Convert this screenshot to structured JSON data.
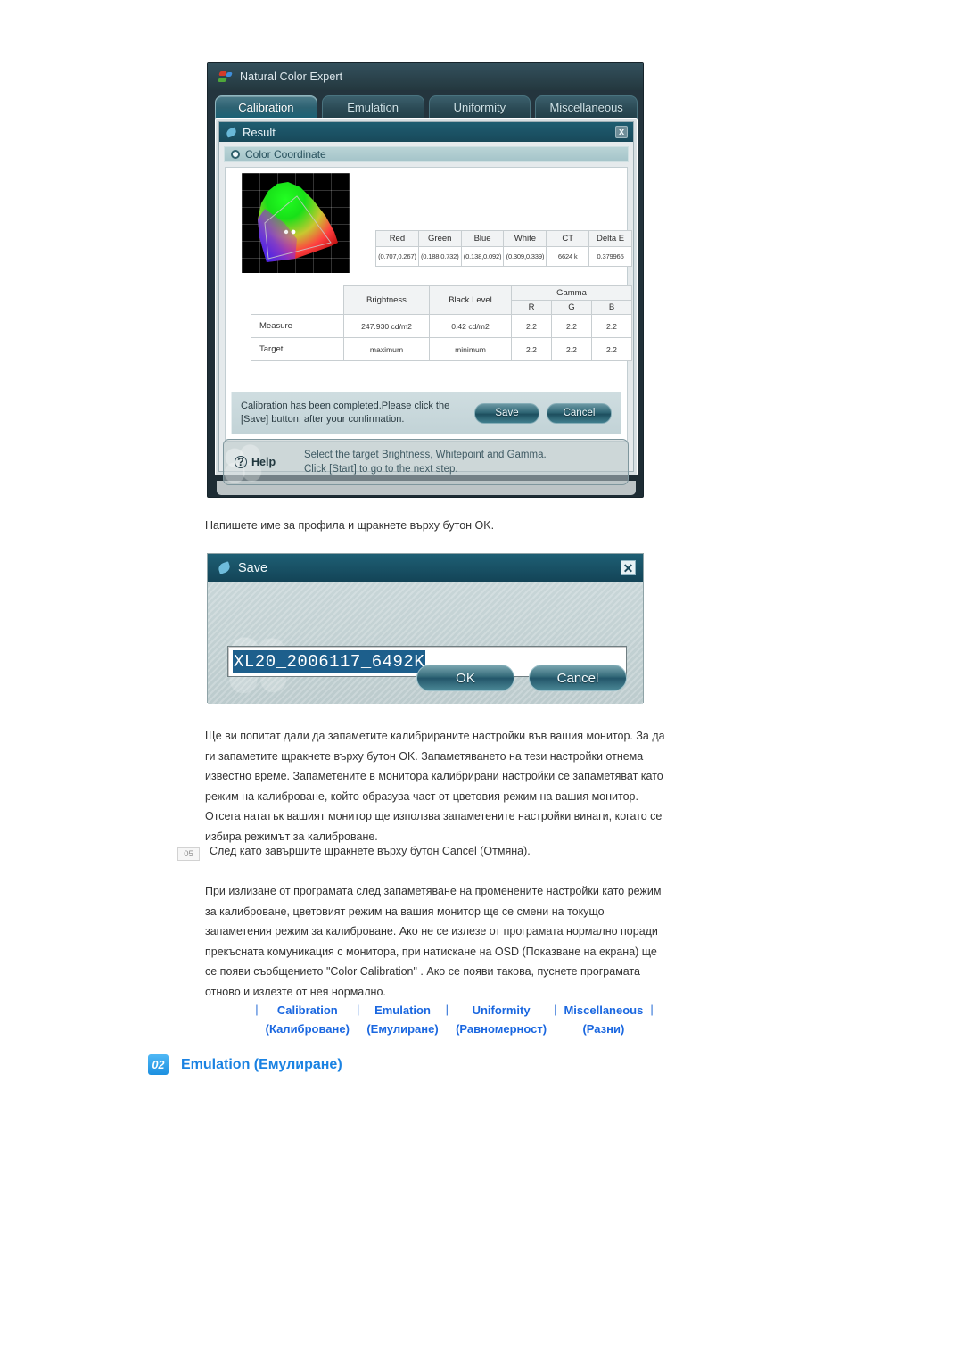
{
  "app": {
    "title": "Natural Color Expert",
    "tabs": [
      {
        "label": "Calibration",
        "active": true
      },
      {
        "label": "Emulation",
        "active": false
      },
      {
        "label": "Uniformity",
        "active": false
      },
      {
        "label": "Miscellaneous",
        "active": false
      }
    ],
    "result_panel": {
      "title": "Result",
      "close_label": "x",
      "section_title": "Color Coordinate",
      "color_table": {
        "headers": [
          "Red",
          "Green",
          "Blue",
          "White",
          "CT",
          "Delta E"
        ],
        "values": [
          "(0.707,0.267)",
          "(0.188,0.732)",
          "(0.138,0.092)",
          "(0.309,0.339)",
          "6624 k",
          "0.379965"
        ]
      },
      "measure_table": {
        "col_brightness": "Brightness",
        "col_black_level": "Black Level",
        "col_gamma": "Gamma",
        "gamma_subheaders": [
          "R",
          "G",
          "B"
        ],
        "rows": [
          {
            "name": "Measure",
            "brightness": "247.930 cd/m2",
            "black_level": "0.42 cd/m2",
            "gamma_r": "2.2",
            "gamma_g": "2.2",
            "gamma_b": "2.2"
          },
          {
            "name": "Target",
            "brightness": "maximum",
            "black_level": "minimum",
            "gamma_r": "2.2",
            "gamma_g": "2.2",
            "gamma_b": "2.2"
          }
        ]
      },
      "message": "Calibration has been completed.Please click the [Save] button, after your confirmation.",
      "save_button": "Save",
      "cancel_button": "Cancel"
    },
    "help": {
      "label": "Help",
      "line1": "Select the target Brightness, Whitepoint and Gamma.",
      "line2": "Click [Start] to go to the next step."
    }
  },
  "doc": {
    "intro_line": "Напишете име за профила и щракнете върху бутон OK.",
    "paragraph1": "Ще ви попитат дали да запаметите калибрираните настройки във вашия монитор. За да ги запаметите щракнете върху бутон OK. Запаметяването на тези настройки отнема известно време. Запаметените в монитора калибрирани настройки се запаметяват като режим на калиброване, който образува част от цветовия режим на вашия монитор. Отсега нататък вашият монитор ще използва запаметените настройки винаги, когато се избира режимът за калиброване.",
    "step_number": "05",
    "step_text": "След като завършите щракнете върху бутон Cancel (Отмяна).",
    "paragraph2": "При излизане от програмата след запаметяване на променените настройки като режим за калиброване, цветовият режим на вашия монитор ще се смени на токущо запаметения режим за калиброване. Ако не се излезе от програмата нормално поради прекъсната комуникация с монитора, при натискане на OSD (Показване на екрана) ще се появи съобщението \"Color Calibration\" . Ако се появи такова, пуснете програмата отново и излезте от нея нормално."
  },
  "save_dialog": {
    "title": "Save",
    "close_label": "✕",
    "profile_name": "XL20_2006117_6492K",
    "placeholder": "",
    "ok_button": "OK",
    "cancel_button": "Cancel"
  },
  "nav": {
    "separator": "|",
    "items": [
      {
        "en": "Calibration",
        "bg": "(Калиброване)"
      },
      {
        "en": "Emulation",
        "bg": "(Емулиране)"
      },
      {
        "en": "Uniformity",
        "bg": "(Равномерност)"
      },
      {
        "en": "Miscellaneous",
        "bg": "(Разни)"
      }
    ]
  },
  "section": {
    "number": "02",
    "title": "Emulation (Емулиране)"
  },
  "colors": {
    "link": "#1a67e0",
    "heading": "#1a82e2",
    "titlebar": "#134457",
    "tab_active": "#1b6276"
  }
}
